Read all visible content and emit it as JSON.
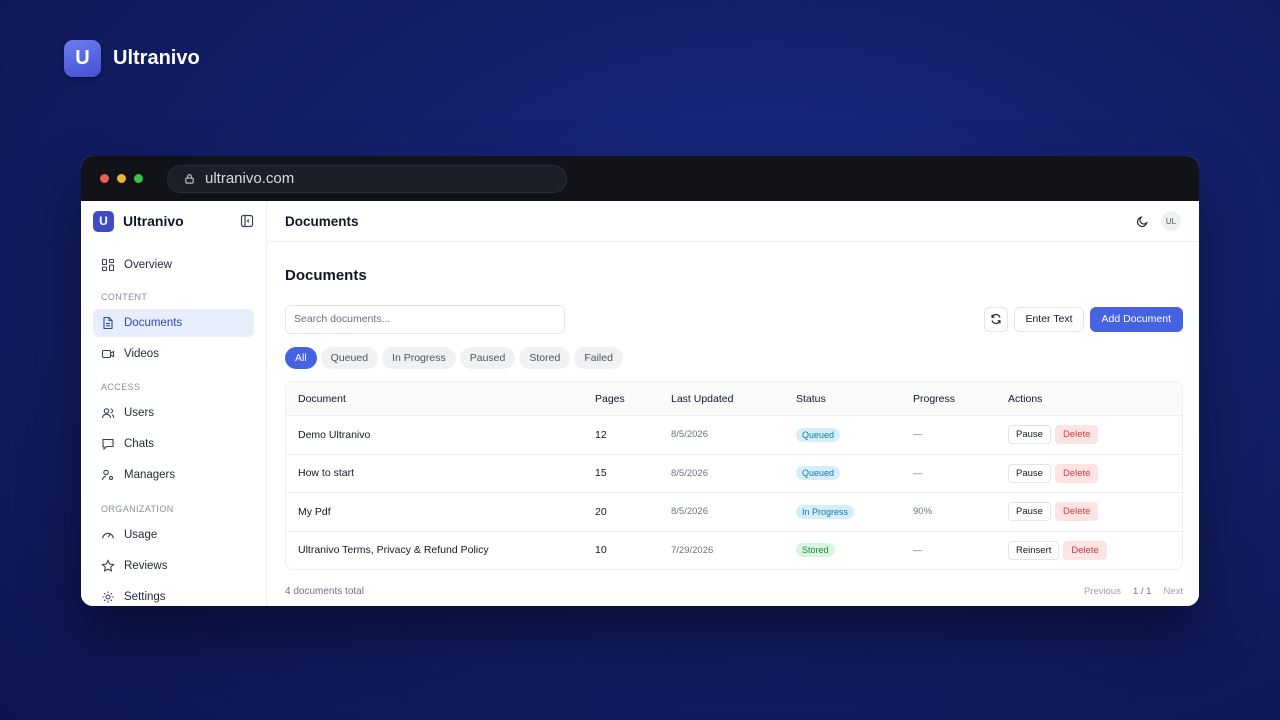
{
  "brand": {
    "logo_letter": "U",
    "name": "Ultranivo"
  },
  "browser": {
    "url": "ultranivo.com"
  },
  "sidebar": {
    "logo_letter": "U",
    "title": "Ultranivo",
    "overview": "Overview",
    "sections": {
      "content": "CONTENT",
      "access": "ACCESS",
      "organization": "ORGANIZATION"
    },
    "items": {
      "documents": "Documents",
      "videos": "Videos",
      "users": "Users",
      "chats": "Chats",
      "managers": "Managers",
      "usage": "Usage",
      "reviews": "Reviews",
      "settings": "Settings"
    }
  },
  "topbar": {
    "title": "Documents",
    "avatar": "UL"
  },
  "main": {
    "title": "Documents",
    "search_placeholder": "Search documents...",
    "enter_text_label": "Enter Text",
    "add_document_label": "Add Document",
    "tabs": [
      "All",
      "Queued",
      "In Progress",
      "Paused",
      "Stored",
      "Failed"
    ],
    "active_tab": "All"
  },
  "table": {
    "headers": [
      "Document",
      "Pages",
      "Last Updated",
      "Status",
      "Progress",
      "Actions"
    ],
    "rows": [
      {
        "document": "Demo Ultranivo",
        "pages": "12",
        "updated": "8/5/2026",
        "status": "Queued",
        "progress": "—",
        "action1": "Pause",
        "action2": "Delete"
      },
      {
        "document": "How to start",
        "pages": "15",
        "updated": "8/5/2026",
        "status": "Queued",
        "progress": "—",
        "action1": "Pause",
        "action2": "Delete"
      },
      {
        "document": "My Pdf",
        "pages": "20",
        "updated": "8/5/2026",
        "status": "In Progress",
        "progress": "90%",
        "action1": "Pause",
        "action2": "Delete"
      },
      {
        "document": "Ultranivo Terms, Privacy & Refund Policy",
        "pages": "10",
        "updated": "7/29/2026",
        "status": "Stored",
        "progress": "—",
        "action1": "Reinsert",
        "action2": "Delete"
      }
    ]
  },
  "footer": {
    "total": "4 documents total",
    "previous": "Previous",
    "page_info": "1 / 1",
    "next": "Next"
  },
  "colors": {
    "accent": "#4563e0",
    "background": "#14206c",
    "queued": "#1679a8",
    "stored": "#1c8a42",
    "danger": "#d23a3a"
  }
}
